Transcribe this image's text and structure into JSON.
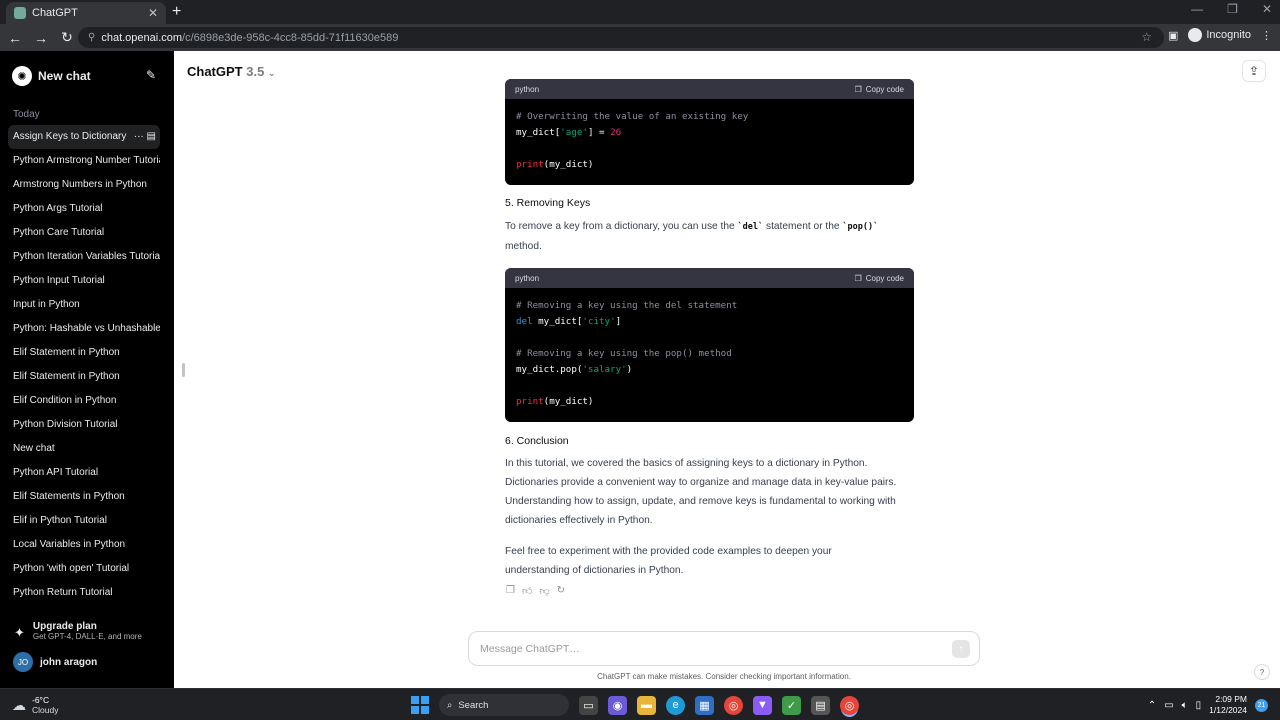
{
  "browser": {
    "tab_title": "ChatGPT",
    "url_host": "chat.openai.com",
    "url_path": "/c/6898e3de-958c-4cc8-85dd-71f11630e589",
    "profile_label": "Incognito"
  },
  "sidebar": {
    "new_chat": "New chat",
    "section_today": "Today",
    "items": [
      {
        "label": "Assign Keys to Dictionary"
      },
      {
        "label": "Python Armstrong Number Tutorial"
      },
      {
        "label": "Armstrong Numbers in Python"
      },
      {
        "label": "Python Args Tutorial"
      },
      {
        "label": "Python Care Tutorial"
      },
      {
        "label": "Python Iteration Variables Tutorial"
      },
      {
        "label": "Python Input Tutorial"
      },
      {
        "label": "Input in Python"
      },
      {
        "label": "Python: Hashable vs Unhashable"
      },
      {
        "label": "Elif Statement in Python"
      },
      {
        "label": "Elif Statement in Python"
      },
      {
        "label": "Elif Condition in Python"
      },
      {
        "label": "Python Division Tutorial"
      },
      {
        "label": "New chat"
      },
      {
        "label": "Python API Tutorial"
      },
      {
        "label": "Elif Statements in Python"
      },
      {
        "label": "Elif in Python Tutorial"
      },
      {
        "label": "Local Variables in Python"
      },
      {
        "label": "Python 'with open' Tutorial"
      },
      {
        "label": "Python Return Tutorial"
      }
    ],
    "upgrade_title": "Upgrade plan",
    "upgrade_sub": "Get GPT-4, DALL·E, and more",
    "user_initials": "JO",
    "user_name": "john aragon"
  },
  "header": {
    "model_name": "ChatGPT",
    "model_version": "3.5"
  },
  "content": {
    "code1_lang": "python",
    "copy_label": "Copy code",
    "code1_comment": "# Overwriting the value of an existing key",
    "code1_var": "my_dict[",
    "code1_key": "'age'",
    "code1_assign": "] = ",
    "code1_num": "26",
    "code1_print": "print",
    "code1_print_arg": "(my_dict)",
    "h5": "5. Removing Keys",
    "p5_a": "To remove a key from a dictionary, you can use the ",
    "p5_del": "`del`",
    "p5_b": " statement or the ",
    "p5_pop": "`pop()`",
    "p5_c": "method.",
    "code2_lang": "python",
    "code2_c1": "# Removing a key using the del statement",
    "code2_kw": "del",
    "code2_l2": " my_dict[",
    "code2_city": "'city'",
    "code2_close": "]",
    "code2_c2": "# Removing a key using the pop() method",
    "code2_pop": "my_dict.pop(",
    "code2_salary": "'salary'",
    "code2_paren": ")",
    "code2_print": "print",
    "code2_print_arg": "(my_dict)",
    "h6": "6. Conclusion",
    "p6": "In this tutorial, we covered the basics of assigning keys to a dictionary in Python. Dictionaries provide a convenient way to organize and manage data in key-value pairs. Understanding how to assign, update, and remove keys is fundamental to working with dictionaries effectively in Python.",
    "p7": "Feel free to experiment with the provided code examples to deepen your understanding of dictionaries in Python."
  },
  "composer": {
    "placeholder": "Message ChatGPT…",
    "disclaimer": "ChatGPT can make mistakes. Consider checking important information.",
    "help": "?"
  },
  "taskbar": {
    "temp": "-6°C",
    "condition": "Cloudy",
    "search": "Search",
    "time": "2:09 PM",
    "date": "1/12/2024",
    "notif_count": "21"
  },
  "colors": {
    "sidebar_bg": "#000000",
    "code_bg": "#000000",
    "code_header_bg": "#343541",
    "string": "#00a67d",
    "number": "#df3079",
    "keyword": "#2e95d3"
  }
}
